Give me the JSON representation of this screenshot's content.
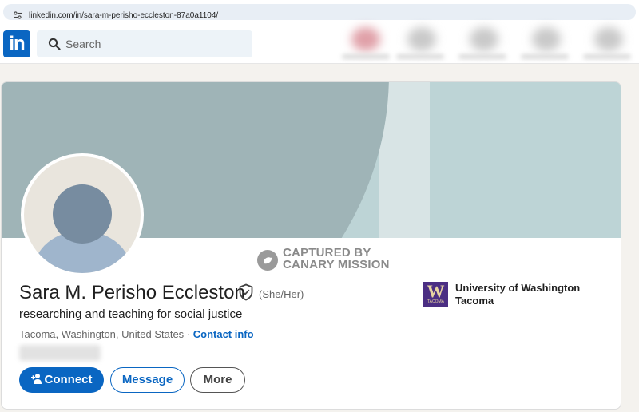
{
  "browser": {
    "url": "linkedin.com/in/sara-m-perisho-eccleston-87a0a1104/"
  },
  "header": {
    "logo_text": "in",
    "search_placeholder": "Search"
  },
  "watermark": {
    "line1": "CAPTURED BY",
    "line2": "CANARY MISSION"
  },
  "profile": {
    "name": "Sara M. Perisho Eccleston",
    "pronouns": "(She/Her)",
    "headline": "researching and teaching for social justice",
    "location": "Tacoma, Washington, United States",
    "location_separator": " · ",
    "contact_info_label": "Contact info"
  },
  "education": {
    "name": "University of Washington Tacoma",
    "logo_letter": "W",
    "logo_word": "TACOMA"
  },
  "actions": {
    "connect_label": "Connect",
    "message_label": "Message",
    "more_label": "More"
  },
  "colors": {
    "brand": "#0a66c2",
    "uw_purple": "#4b2e83"
  }
}
